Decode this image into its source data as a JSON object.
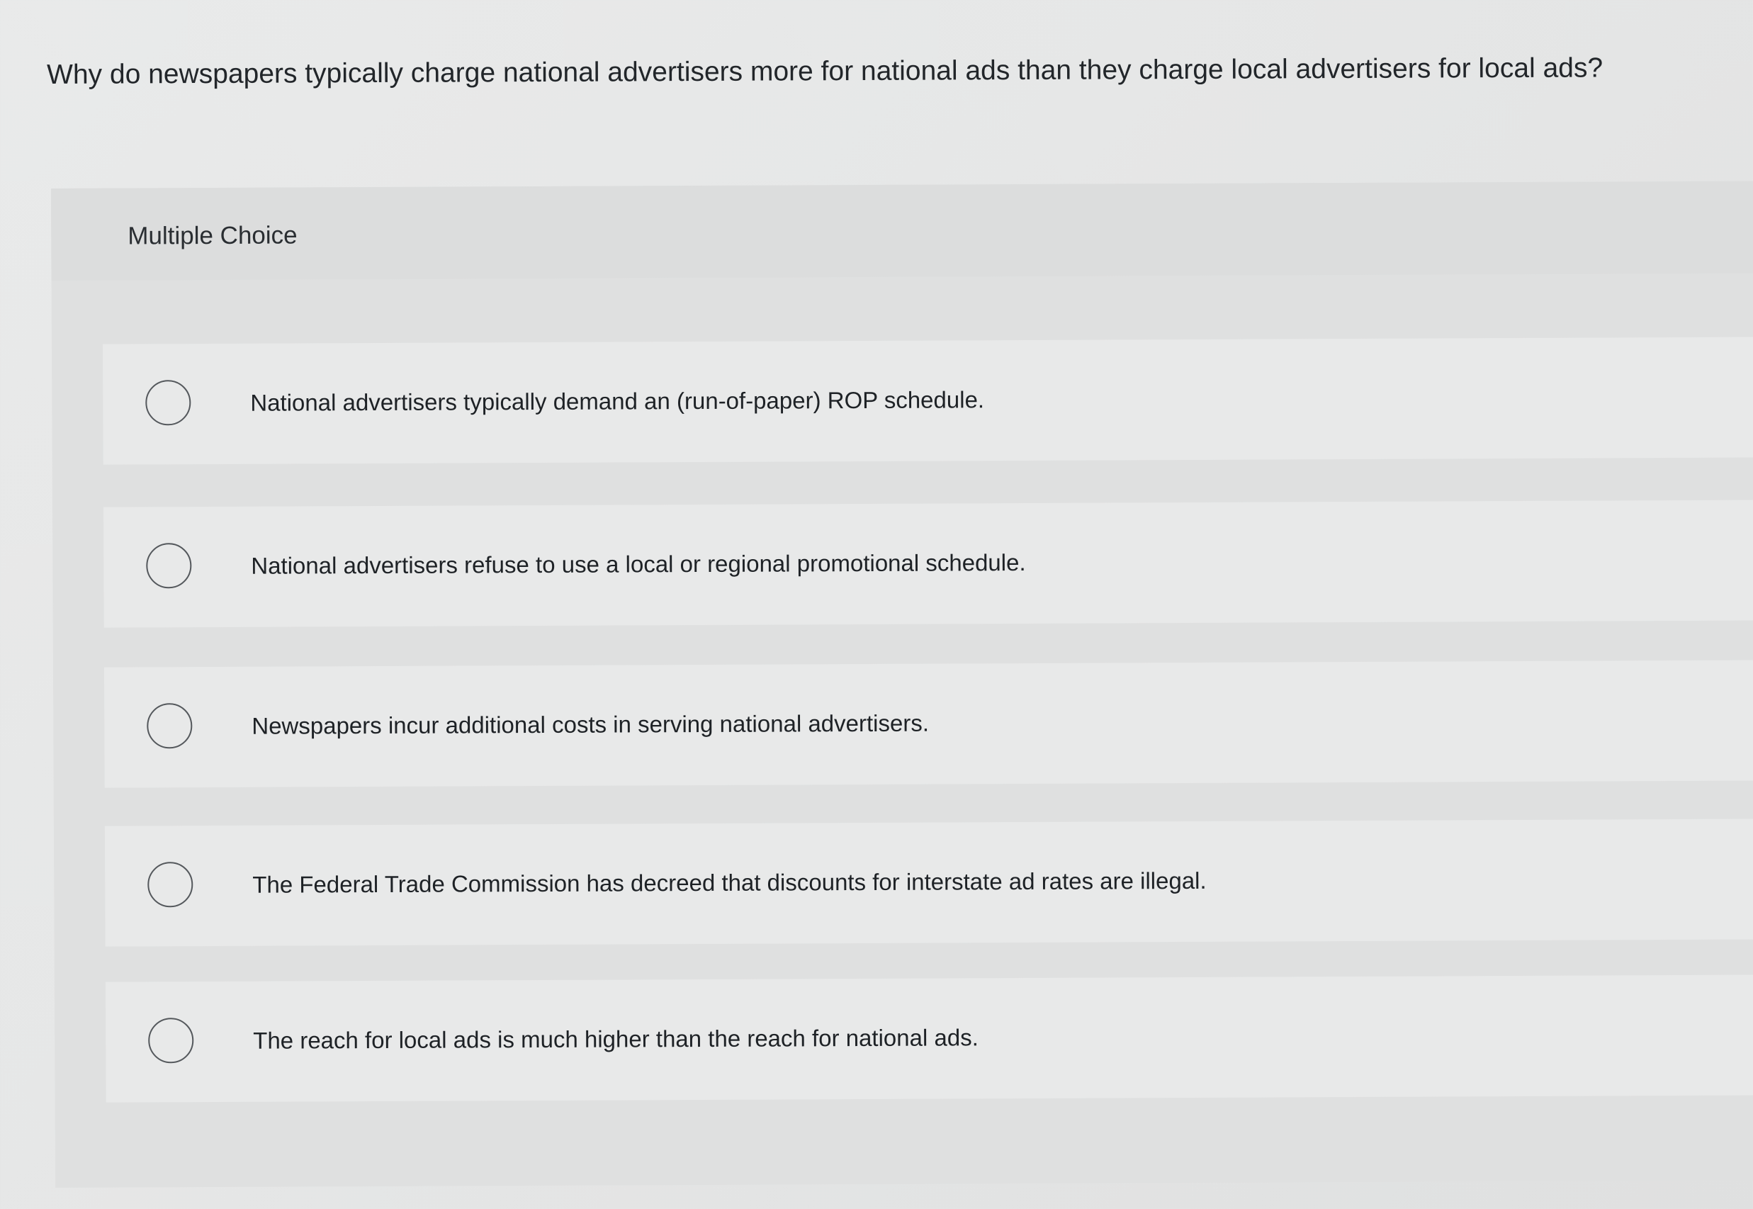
{
  "question": {
    "text": "Why do newspapers typically charge national advertisers more for national ads than they charge local advertisers for local ads?"
  },
  "panel": {
    "type_label": "Multiple Choice"
  },
  "options": [
    {
      "label": "National advertisers typically demand an (run-of-paper) ROP schedule.",
      "selected": false
    },
    {
      "label": "National advertisers refuse to use a local or regional promotional schedule.",
      "selected": false
    },
    {
      "label": "Newspapers incur additional costs in serving national advertisers.",
      "selected": false
    },
    {
      "label": "The Federal Trade Commission has decreed that discounts for interstate ad rates are illegal.",
      "selected": false
    },
    {
      "label": "The reach for local ads is much higher than the reach for national ads.",
      "selected": false
    }
  ],
  "colors": {
    "background": "#e7e8e8",
    "panel": "#dfe0e0",
    "option_row": "#e8e9e9",
    "text": "#1f2226",
    "radio_border": "#54585c"
  }
}
